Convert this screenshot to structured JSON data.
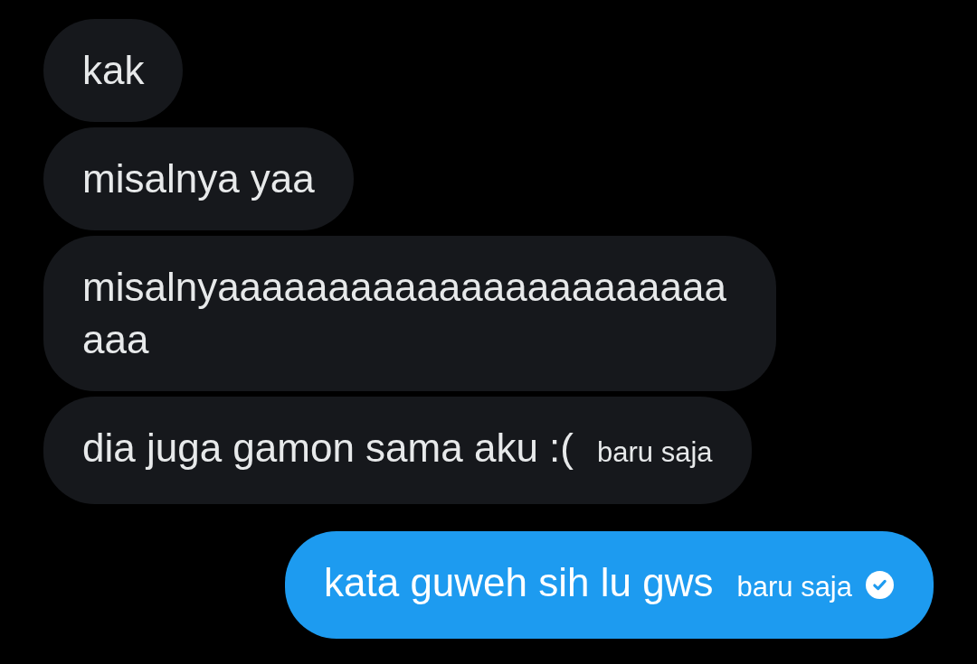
{
  "messages": [
    {
      "kind": "received",
      "text": "kak"
    },
    {
      "kind": "received",
      "text": "misalnya yaa"
    },
    {
      "kind": "received",
      "text": "misalnyaaaaaaaaaaaaaaaaaaaaaaaaaa"
    },
    {
      "kind": "received",
      "text": "dia juga gamon sama aku :(",
      "time": "baru saja"
    },
    {
      "kind": "sent",
      "text": "kata guweh sih lu gws",
      "time": "baru saja",
      "read": true
    }
  ]
}
